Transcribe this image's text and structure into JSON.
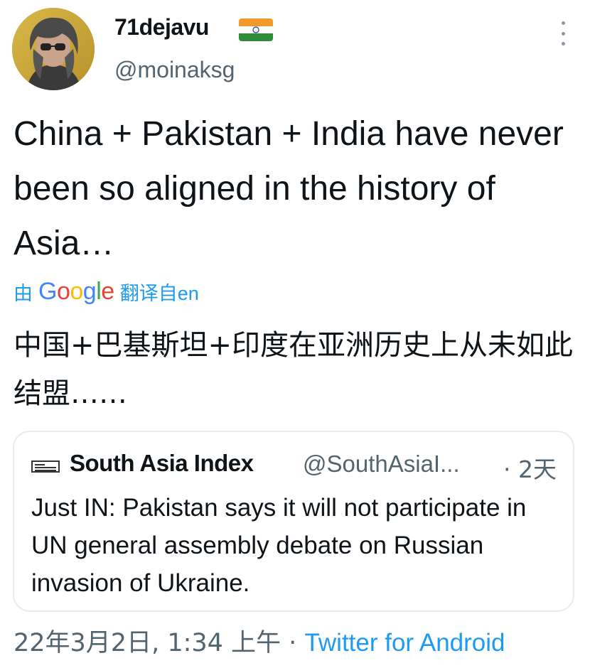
{
  "author": {
    "display_name": "71dejavu",
    "handle": "@moinaksg",
    "flag_icon": "india-flag-icon"
  },
  "tweet": {
    "text": "China + Pakistan + India have never been so aligned in the history of Asia…"
  },
  "translation": {
    "prefix": "由",
    "google_letters": [
      "G",
      "o",
      "o",
      "g",
      "l",
      "e"
    ],
    "suffix": "翻译自en",
    "text": "中国+巴基斯坦+印度在亚洲历史上从未如此结盟……"
  },
  "quoted_tweet": {
    "display_name": "South Asia Index",
    "handle": "@SouthAsiaI...",
    "time": "· 2天",
    "text": "Just IN: Pakistan says it will not participate in UN general assembly debate on Russian invasion of Ukraine."
  },
  "footer": {
    "timestamp": "22年3月2日, 1:34 上午 ·",
    "source": "Twitter for Android"
  },
  "colors": {
    "link_blue": "#1d9bf0",
    "secondary_text": "#536471",
    "primary_text": "#0f1419",
    "card_border": "#e6ecf0"
  }
}
